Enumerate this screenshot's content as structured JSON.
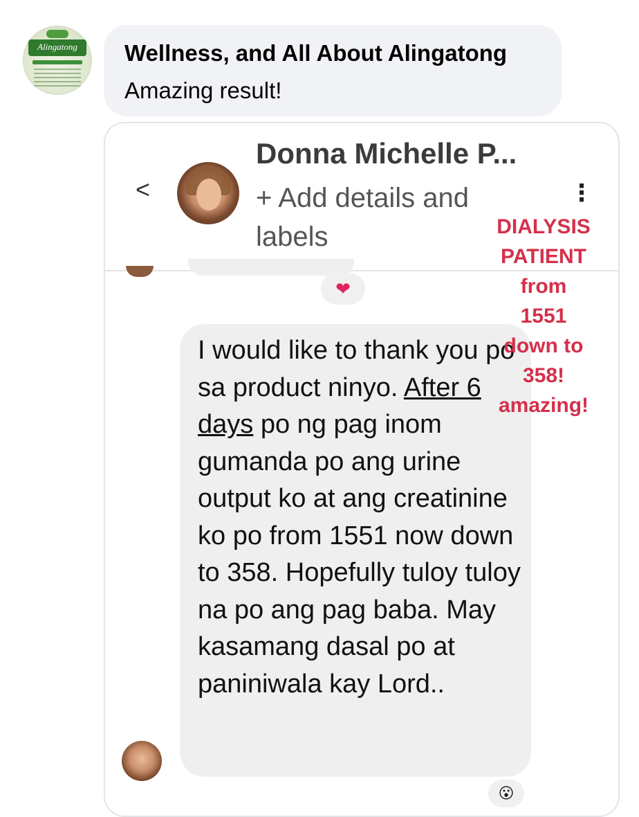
{
  "comment": {
    "author": "Wellness, and All About Alingatong",
    "text": "Amazing result!",
    "avatar_logo_text": "Alingatong"
  },
  "screenshot": {
    "contact_name": "Donna Michelle P...",
    "add_details": "+ Add details and labels",
    "back_icon": "<",
    "more_icon": "⋮",
    "heart_reaction": "❤",
    "wow_reaction": "😮",
    "message": {
      "before_underline": "I would like to thank you po sa product ninyo. ",
      "underlined": "After 6 days",
      "after_underline": " po ng pag inom gumanda po ang urine output ko at ang creatinine ko po from 1551 now down to 358. Hopefully tuloy tuloy na po ang pag baba. May kasamang dasal po at paniniwala kay Lord.."
    }
  },
  "overlay_note": "DIALYSIS\nPATIENT\nfrom\n1551\ndown to\n358!\namazing!",
  "colors": {
    "comment_bubble": "#f0f2f5",
    "overlay_red": "#d4304a",
    "message_bubble": "#efefef"
  }
}
